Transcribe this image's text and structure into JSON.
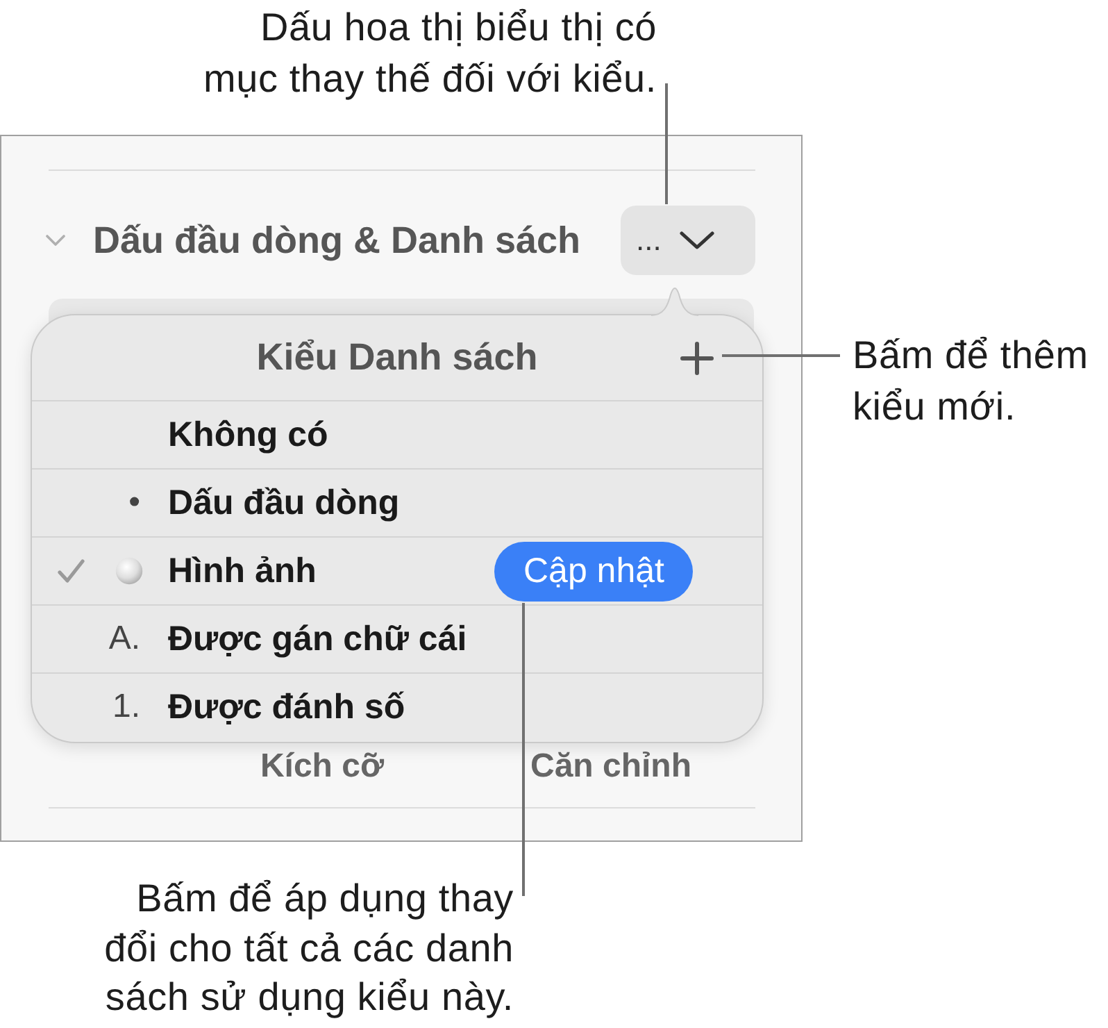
{
  "top_callout": {
    "lines": [
      "Dấu hoa thị biểu thị có",
      "mục thay thế đối với kiểu."
    ]
  },
  "panel": {
    "section": {
      "title": "Dấu đầu dòng & Danh sách",
      "expanded": true
    },
    "menu_button": {
      "label": "..."
    },
    "popover": {
      "title": "Kiểu Danh sách",
      "items": [
        {
          "label": "Không có",
          "kind": "none",
          "selected": false
        },
        {
          "label": "Dấu đầu dòng",
          "kind": "text",
          "marker": "•",
          "selected": false
        },
        {
          "label": "Hình ảnh",
          "kind": "image",
          "selected": true,
          "action": "Cập nhật"
        },
        {
          "label": "Được gán chữ cái",
          "kind": "text",
          "marker": "A.",
          "selected": false
        },
        {
          "label": "Được đánh số",
          "kind": "text",
          "marker": "1.",
          "selected": false
        }
      ]
    },
    "labels": [
      "Kích cỡ",
      "Căn chỉnh"
    ]
  },
  "right_callout": {
    "lines": [
      "Bấm để thêm",
      "kiểu mới."
    ]
  },
  "bottom_callout": {
    "lines": [
      "Bấm để áp dụng thay",
      "đổi cho tất cả các danh",
      "sách sử dụng kiểu này."
    ]
  }
}
